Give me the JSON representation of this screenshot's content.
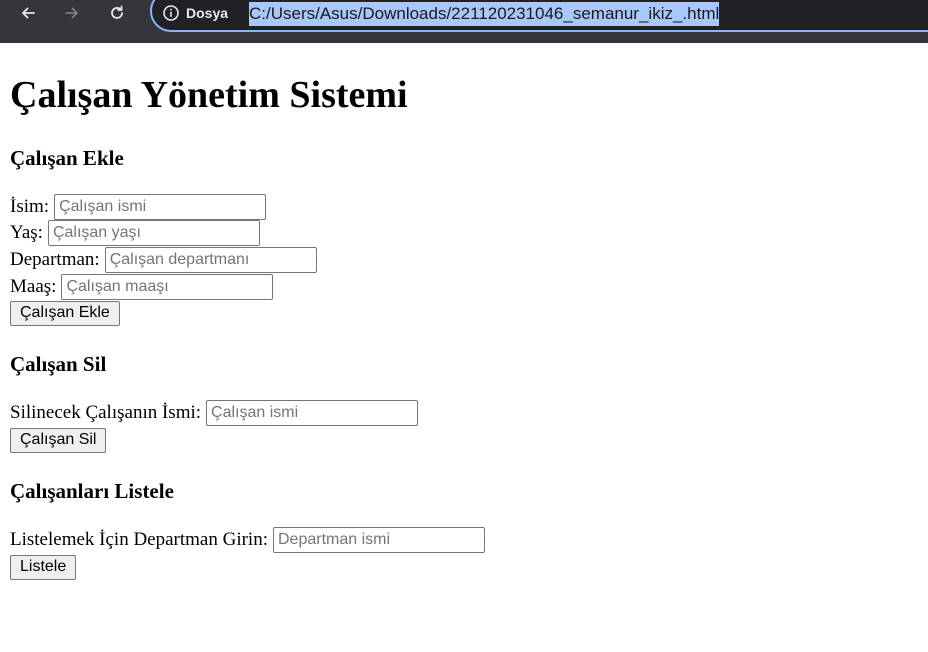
{
  "browser": {
    "security_label": "Dosya",
    "url": "C:/Users/Asus/Downloads/221120231046_semanur_ikiz_.html"
  },
  "page": {
    "title": "Çalışan Yönetim Sistemi",
    "add_section": {
      "heading": "Çalışan Ekle",
      "name_label": "İsim:",
      "name_placeholder": "Çalışan ismi",
      "age_label": "Yaş:",
      "age_placeholder": "Çalışan yaşı",
      "dept_label": "Departman:",
      "dept_placeholder": "Çalışan departmanı",
      "salary_label": "Maaş:",
      "salary_placeholder": "Çalışan maaşı",
      "button": "Çalışan Ekle"
    },
    "delete_section": {
      "heading": "Çalışan Sil",
      "name_label": "Silinecek Çalışanın İsmi:",
      "name_placeholder": "Çalışan ismi",
      "button": "Çalışan Sil"
    },
    "list_section": {
      "heading": "Çalışanları Listele",
      "dept_label": "Listelemek İçin Departman Girin:",
      "dept_placeholder": "Departman ismi",
      "button": "Listele"
    }
  }
}
